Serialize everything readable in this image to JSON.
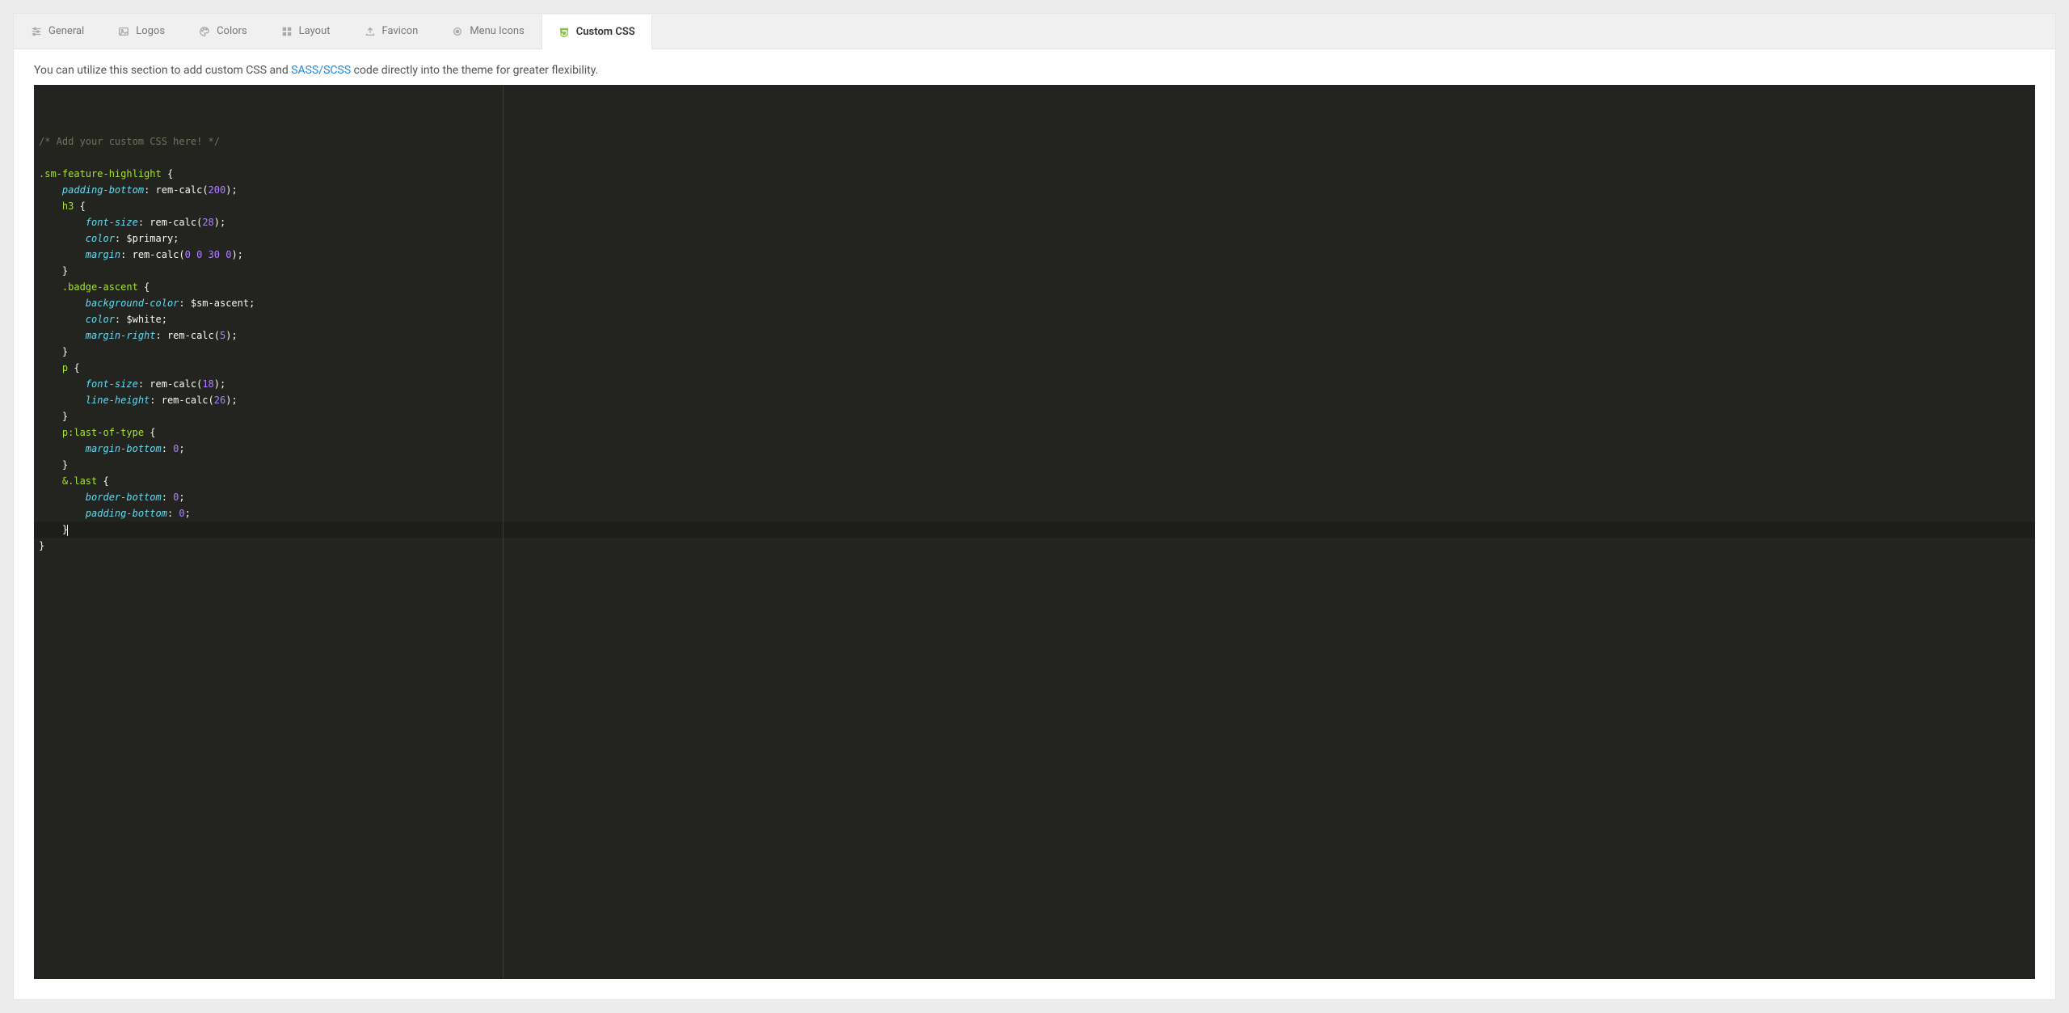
{
  "tabs": {
    "items": [
      {
        "label": "General",
        "icon": "sliders-icon",
        "active": false
      },
      {
        "label": "Logos",
        "icon": "image-icon",
        "active": false
      },
      {
        "label": "Colors",
        "icon": "palette-icon",
        "active": false
      },
      {
        "label": "Layout",
        "icon": "grid-icon",
        "active": false
      },
      {
        "label": "Favicon",
        "icon": "upload-icon",
        "active": false
      },
      {
        "label": "Menu Icons",
        "icon": "target-icon",
        "active": false
      },
      {
        "label": "Custom CSS",
        "icon": "css3-icon",
        "active": true
      }
    ]
  },
  "description": {
    "pre": "You can utilize this section to add custom CSS and ",
    "link_text": "SASS/SCSS",
    "post": " code directly into the theme for greater flexibility."
  },
  "editor": {
    "lines": [
      {
        "t": "comment",
        "text": "/* Add your custom CSS here! */"
      },
      {
        "t": "blank",
        "text": ""
      },
      {
        "t": "sel",
        "tokens": [
          [
            "sel",
            ".sm-feature-highlight"
          ],
          [
            "punc",
            " {"
          ]
        ]
      },
      {
        "t": "rule",
        "indent": 1,
        "prop": "padding-bottom",
        "valtokens": [
          [
            "fn",
            "rem-calc("
          ],
          [
            "num",
            "200"
          ],
          [
            "fn",
            ")"
          ],
          [
            "punc",
            ";"
          ]
        ]
      },
      {
        "t": "sel",
        "indent": 1,
        "tokens": [
          [
            "sel",
            "h3"
          ],
          [
            "punc",
            " {"
          ]
        ]
      },
      {
        "t": "rule",
        "indent": 2,
        "prop": "font-size",
        "valtokens": [
          [
            "fn",
            "rem-calc("
          ],
          [
            "num",
            "28"
          ],
          [
            "fn",
            ")"
          ],
          [
            "punc",
            ";"
          ]
        ]
      },
      {
        "t": "rule",
        "indent": 2,
        "prop": "color",
        "valtokens": [
          [
            "var",
            "$primary"
          ],
          [
            "punc",
            ";"
          ]
        ]
      },
      {
        "t": "rule",
        "indent": 2,
        "prop": "margin",
        "valtokens": [
          [
            "fn",
            "rem-calc("
          ],
          [
            "num",
            "0 0 30 0"
          ],
          [
            "fn",
            ")"
          ],
          [
            "punc",
            ";"
          ]
        ]
      },
      {
        "t": "close",
        "indent": 1
      },
      {
        "t": "sel",
        "indent": 1,
        "tokens": [
          [
            "sel",
            ".badge-ascent"
          ],
          [
            "punc",
            " {"
          ]
        ]
      },
      {
        "t": "rule",
        "indent": 2,
        "prop": "background-color",
        "valtokens": [
          [
            "var",
            "$sm-ascent"
          ],
          [
            "punc",
            ";"
          ]
        ]
      },
      {
        "t": "rule",
        "indent": 2,
        "prop": "color",
        "valtokens": [
          [
            "var",
            "$white"
          ],
          [
            "punc",
            ";"
          ]
        ]
      },
      {
        "t": "rule",
        "indent": 2,
        "prop": "margin-right",
        "valtokens": [
          [
            "fn",
            "rem-calc("
          ],
          [
            "num",
            "5"
          ],
          [
            "fn",
            ")"
          ],
          [
            "punc",
            ";"
          ]
        ]
      },
      {
        "t": "close",
        "indent": 1
      },
      {
        "t": "sel",
        "indent": 1,
        "tokens": [
          [
            "sel",
            "p"
          ],
          [
            "punc",
            " {"
          ]
        ]
      },
      {
        "t": "rule",
        "indent": 2,
        "prop": "font-size",
        "valtokens": [
          [
            "fn",
            "rem-calc("
          ],
          [
            "num",
            "18"
          ],
          [
            "fn",
            ")"
          ],
          [
            "punc",
            ";"
          ]
        ]
      },
      {
        "t": "rule",
        "indent": 2,
        "prop": "line-height",
        "valtokens": [
          [
            "fn",
            "rem-calc("
          ],
          [
            "num",
            "26"
          ],
          [
            "fn",
            ")"
          ],
          [
            "punc",
            ";"
          ]
        ]
      },
      {
        "t": "close",
        "indent": 1
      },
      {
        "t": "sel",
        "indent": 1,
        "tokens": [
          [
            "sel",
            "p:last-of-type"
          ],
          [
            "punc",
            " {"
          ]
        ]
      },
      {
        "t": "rule",
        "indent": 2,
        "prop": "margin-bottom",
        "valtokens": [
          [
            "num",
            "0"
          ],
          [
            "punc",
            ";"
          ]
        ]
      },
      {
        "t": "close",
        "indent": 1
      },
      {
        "t": "sel",
        "indent": 1,
        "tokens": [
          [
            "sel",
            "&.last"
          ],
          [
            "punc",
            " {"
          ]
        ]
      },
      {
        "t": "rule",
        "indent": 2,
        "prop": "border-bottom",
        "valtokens": [
          [
            "num",
            "0"
          ],
          [
            "punc",
            ";"
          ]
        ]
      },
      {
        "t": "rule",
        "indent": 2,
        "prop": "padding-bottom",
        "valtokens": [
          [
            "num",
            "0"
          ],
          [
            "punc",
            ";"
          ]
        ]
      },
      {
        "t": "close",
        "indent": 1,
        "current": true
      },
      {
        "t": "close",
        "indent": 0
      }
    ]
  }
}
